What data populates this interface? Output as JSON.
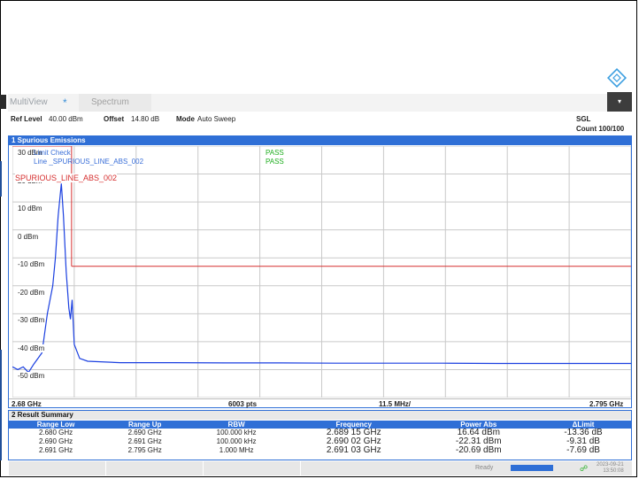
{
  "tabs": {
    "multiview": "MultiView",
    "star": "*",
    "spectrum": "Spectrum"
  },
  "menu_label": "▾",
  "settings": {
    "ref_level_label": "Ref Level",
    "ref_level_value": "40.00 dBm",
    "offset_label": "Offset",
    "offset_value": "14.80 dB",
    "mode_label": "Mode",
    "mode_value": "Auto Sweep",
    "sgl": "SGL",
    "count": "Count 100/100"
  },
  "window1": {
    "title": "1 Spurious Emissions",
    "limit_check_label": "Limit Check",
    "line_label": "Line _SPURIOUS_LINE_ABS_002",
    "limit_check_result": "PASS",
    "line_result": "PASS",
    "limit_line_name": "SPURIOUS_LINE_ABS_002",
    "footer": {
      "start": "2.68 GHz",
      "points": "6003 pts",
      "span_per_div": "11.5 MHz/",
      "stop": "2.795 GHz"
    }
  },
  "chart_data": {
    "type": "line",
    "x_unit": "GHz",
    "y_unit": "dBm",
    "xlim": [
      2.68,
      2.795
    ],
    "ylim": [
      -60,
      30
    ],
    "y_ticks": [
      {
        "value": 30,
        "label": "30 dBm"
      },
      {
        "value": 20,
        "label": "20 dBm"
      },
      {
        "value": 10,
        "label": "10 dBm"
      },
      {
        "value": 0,
        "label": "0 dBm"
      },
      {
        "value": -10,
        "label": "-10 dBm"
      },
      {
        "value": -20,
        "label": "-20 dBm"
      },
      {
        "value": -30,
        "label": "-30 dBm"
      },
      {
        "value": -40,
        "label": "-40 dBm"
      },
      {
        "value": -50,
        "label": "-50 dBm"
      }
    ],
    "grid": true,
    "limit_line": {
      "name": "SPURIOUS_LINE_ABS_002",
      "segments": [
        {
          "x": [
            2.68,
            2.689
          ],
          "y": 30
        },
        {
          "x": [
            2.689,
            2.691
          ],
          "y": 30
        },
        {
          "x": [
            2.691,
            2.795
          ],
          "y": -13
        }
      ]
    },
    "trace": [
      [
        2.68,
        -49
      ],
      [
        2.681,
        -50
      ],
      [
        2.682,
        -49
      ],
      [
        2.683,
        -51
      ],
      [
        2.684,
        -48
      ],
      [
        2.6855,
        -44
      ],
      [
        2.6865,
        -30
      ],
      [
        2.6875,
        -20
      ],
      [
        2.688,
        -10
      ],
      [
        2.6885,
        5
      ],
      [
        2.6891,
        16.6
      ],
      [
        2.6895,
        5
      ],
      [
        2.69,
        -15
      ],
      [
        2.6905,
        -28
      ],
      [
        2.6908,
        -32
      ],
      [
        2.6911,
        -25
      ],
      [
        2.6915,
        -41
      ],
      [
        2.6925,
        -46
      ],
      [
        2.694,
        -47
      ],
      [
        2.7,
        -47.5
      ],
      [
        2.71,
        -47.5
      ],
      [
        2.72,
        -47.6
      ],
      [
        2.73,
        -47.6
      ],
      [
        2.74,
        -47.7
      ],
      [
        2.75,
        -47.7
      ],
      [
        2.76,
        -47.7
      ],
      [
        2.77,
        -47.8
      ],
      [
        2.78,
        -47.8
      ],
      [
        2.795,
        -47.8
      ]
    ]
  },
  "window2": {
    "title": "2 Result Summary",
    "columns": [
      "Range Low",
      "Range Up",
      "RBW",
      "Frequency",
      "Power Abs",
      "ΔLimit"
    ],
    "rows": [
      [
        "2.680 GHz",
        "2.690 GHz",
        "100.000 kHz",
        "2.689 15 GHz",
        "16.64 dBm",
        "-13.36 dB"
      ],
      [
        "2.690 GHz",
        "2.691 GHz",
        "100.000 kHz",
        "2.690 02 GHz",
        "-22.31 dBm",
        "-9.31 dB"
      ],
      [
        "2.691 GHz",
        "2.795 GHz",
        "1.000 MHz",
        "2.691 03 GHz",
        "-20.69 dBm",
        "-7.69 dB"
      ]
    ]
  },
  "status": {
    "ready": "Ready",
    "progress": 1.0,
    "date": "2023-09-21",
    "time": "13:50:08"
  },
  "colors": {
    "accent": "#2f6fd6",
    "trace": "#1a3fe0",
    "limit": "#d62f2f",
    "pass": "#1fae1f"
  }
}
